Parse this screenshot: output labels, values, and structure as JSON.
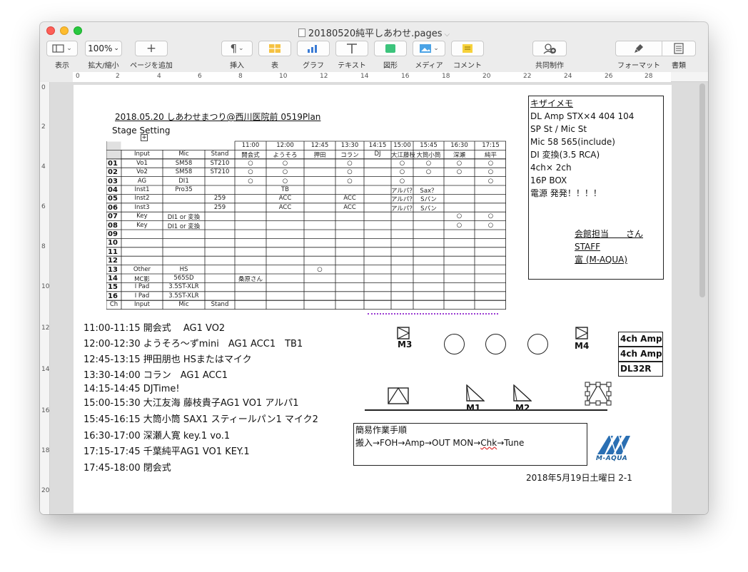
{
  "window": {
    "title": "20180520純平しあわせ.pages"
  },
  "toolbar": {
    "view": {
      "label": "表示"
    },
    "zoom": {
      "label": "拡大/縮小",
      "value": "100%"
    },
    "add_page": {
      "label": "ページを追加"
    },
    "insert": {
      "label": "挿入"
    },
    "table": {
      "label": "表"
    },
    "chart": {
      "label": "グラフ"
    },
    "text": {
      "label": "テキスト"
    },
    "shape": {
      "label": "図形"
    },
    "media": {
      "label": "メディア"
    },
    "comment": {
      "label": "コメント"
    },
    "collaborate": {
      "label": "共同制作"
    },
    "format": {
      "label": "フォーマット"
    },
    "document": {
      "label": "書類"
    }
  },
  "ruler": {
    "h_numbers": [
      "0",
      "2",
      "4",
      "6",
      "8",
      "10",
      "12",
      "14",
      "16",
      "18",
      "20",
      "22",
      "24",
      "26",
      "28"
    ],
    "v_numbers": [
      "0",
      "2",
      "4",
      "6",
      "8",
      "10",
      "12",
      "14",
      "16",
      "18",
      "20"
    ]
  },
  "doc": {
    "heading": "2018.05.20 しあわせまつり@西川医院前 0519Plan",
    "stage_setting": "Stage Setting",
    "table": {
      "times": [
        "11:00",
        "12:00",
        "12:45",
        "13:30",
        "14:15",
        "15:00",
        "15:45",
        "16:30",
        "17:15"
      ],
      "header": {
        "input": "Input",
        "mic": "Mic",
        "stand": "Stand",
        "perf": [
          "開会式",
          "ようそろ",
          "押田",
          "コラン",
          "DJ",
          "大江藤枝",
          "大筒小筒",
          "深瀬",
          "純平"
        ]
      },
      "rows": [
        {
          "ch": "01",
          "input": "Vo1",
          "mic": "SM58",
          "stand": "ST210",
          "perf": [
            "○",
            "○",
            "",
            "○",
            "",
            "○",
            "○",
            "○",
            "○"
          ]
        },
        {
          "ch": "02",
          "input": "Vo2",
          "mic": "SM58",
          "stand": "ST210",
          "perf": [
            "○",
            "○",
            "",
            "○",
            "",
            "○",
            "○",
            "○",
            "○"
          ]
        },
        {
          "ch": "03",
          "input": "AG",
          "mic": "DI1",
          "stand": "",
          "perf": [
            "○",
            "○",
            "",
            "○",
            "",
            "○",
            "",
            "",
            "○"
          ]
        },
        {
          "ch": "04",
          "input": "Inst1",
          "mic": "Pro35",
          "stand": "",
          "perf": [
            "",
            "TB",
            "",
            "",
            "",
            "アルパ？",
            "Sax？",
            "",
            ""
          ]
        },
        {
          "ch": "05",
          "input": "Inst2",
          "mic": "",
          "stand": "259",
          "perf": [
            "",
            "ACC",
            "",
            "ACC",
            "",
            "アルパ？",
            "Sパン",
            "",
            ""
          ]
        },
        {
          "ch": "06",
          "input": "Inst3",
          "mic": "",
          "stand": "259",
          "perf": [
            "",
            "ACC",
            "",
            "ACC",
            "",
            "アルパ？",
            "Sパン",
            "",
            ""
          ]
        },
        {
          "ch": "07",
          "input": "Key",
          "mic": "DI1 or 変換",
          "stand": "",
          "perf": [
            "",
            "",
            "",
            "",
            "",
            "",
            "",
            "○",
            "○"
          ]
        },
        {
          "ch": "08",
          "input": "Key",
          "mic": "DI1 or 変換",
          "stand": "",
          "perf": [
            "",
            "",
            "",
            "",
            "",
            "",
            "",
            "○",
            "○"
          ]
        },
        {
          "ch": "09",
          "input": "",
          "mic": "",
          "stand": "",
          "perf": [
            "",
            "",
            "",
            "",
            "",
            "",
            "",
            "",
            ""
          ]
        },
        {
          "ch": "10",
          "input": "",
          "mic": "",
          "stand": "",
          "perf": [
            "",
            "",
            "",
            "",
            "",
            "",
            "",
            "",
            ""
          ]
        },
        {
          "ch": "11",
          "input": "",
          "mic": "",
          "stand": "",
          "perf": [
            "",
            "",
            "",
            "",
            "",
            "",
            "",
            "",
            ""
          ]
        },
        {
          "ch": "12",
          "input": "",
          "mic": "",
          "stand": "",
          "perf": [
            "",
            "",
            "",
            "",
            "",
            "",
            "",
            "",
            ""
          ]
        },
        {
          "ch": "13",
          "input": "Other",
          "mic": "HS",
          "stand": "",
          "perf": [
            "",
            "",
            "○",
            "",
            "",
            "",
            "",
            "",
            ""
          ]
        },
        {
          "ch": "14",
          "input": "MC影",
          "mic": "565SD",
          "stand": "",
          "perf": [
            "桑原さん",
            "",
            "",
            "",
            "",
            "",
            "",
            "",
            ""
          ]
        },
        {
          "ch": "15",
          "input": "I Pad",
          "mic": "3.5ST-XLR",
          "stand": "",
          "perf": [
            "",
            "",
            "",
            "",
            "",
            "",
            "",
            "",
            ""
          ]
        },
        {
          "ch": "16",
          "input": "I Pad",
          "mic": "3.5ST-XLR",
          "stand": "",
          "perf": [
            "",
            "",
            "",
            "",
            "",
            "",
            "",
            "",
            ""
          ]
        }
      ],
      "footer": {
        "ch": "Ch",
        "input": "Input",
        "mic": "Mic",
        "stand": "Stand"
      }
    },
    "memo": {
      "title": "キザイメモ",
      "lines": [
        "DL Amp STX×4 404 104",
        "SP St / Mic St",
        "Mic 58 565(include)",
        "DI 変換(3.5 RCA)",
        "4ch× 2ch",
        "16P BOX",
        "電源 発発！！！！"
      ],
      "staff": [
        "会館担当　　さん",
        "STAFF",
        "富 (M-AQUA)"
      ]
    },
    "schedule": [
      "11:00-11:15 開会式　 AG1 VO2",
      "12:00-12:30 ようそろ〜ずmini　AG1 ACC1　TB1",
      "12:45-13:15 押田朋也 HSまたはマイク",
      "13:30-14:00 コラン　AG1 ACC1",
      "14:15-14:45 DJTime!",
      "15:00-15:30 大江友海 藤枝貴子AG1 VO1 アルパ1",
      "15:45-16:15 大筒小筒 SAX1  スティールパン1 マイク2",
      "16:30-17:00 深瀬人寛 key.1 vo.1",
      "17:15-17:45 千葉純平AG1 VO1  KEY.1",
      "17:45-18:00 閉会式"
    ],
    "stage": {
      "m3": "M3",
      "m4": "M4",
      "m1": "M1",
      "m2": "M2",
      "amp1": "4ch Amp",
      "amp2": "4ch Amp",
      "mixer": "DL32R"
    },
    "procedure": {
      "title": "簡易作業手順",
      "pre": "搬入→FOH→Amp→OUT MON→",
      "chk": "Chk",
      "post": "→Tune"
    },
    "logo_text": "M-AQUA",
    "footer_date": "2018年5月19日土曜日 2-1"
  }
}
